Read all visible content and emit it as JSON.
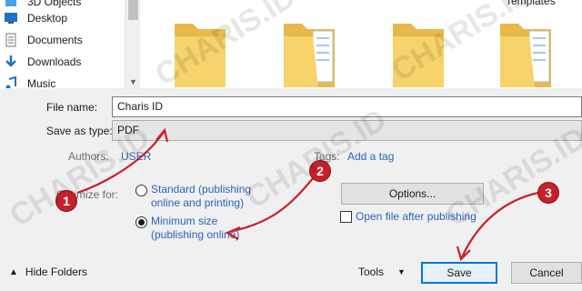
{
  "nav": {
    "items": [
      {
        "label": "3D Objects",
        "icon": "3d-objects-icon"
      },
      {
        "label": "Desktop",
        "icon": "desktop-icon"
      },
      {
        "label": "Documents",
        "icon": "documents-icon"
      },
      {
        "label": "Downloads",
        "icon": "downloads-icon"
      },
      {
        "label": "Music",
        "icon": "music-icon"
      }
    ]
  },
  "folders": {
    "last_label": "Templates"
  },
  "form": {
    "filename_label": "File name:",
    "filename_value": "Charis ID",
    "savetype_label": "Save as type:",
    "savetype_value": "PDF",
    "authors_label": "Authors:",
    "authors_value": "USER",
    "tags_label": "Tags:",
    "tags_value": "Add a tag",
    "optimize_label": "Optimize for:",
    "opt_standard": "Standard (publishing online and printing)",
    "opt_minimum": "Minimum size (publishing online)",
    "options_button": "Options...",
    "open_after_label": "Open file after publishing"
  },
  "footer": {
    "hide_folders": "Hide Folders",
    "tools": "Tools",
    "save": "Save",
    "cancel": "Cancel"
  },
  "annotations": {
    "badge1": "1",
    "badge2": "2",
    "badge3": "3",
    "watermark": "CHARIS.ID"
  },
  "colors": {
    "link": "#2b63b8",
    "badge": "#c8202a",
    "primary_border": "#0078d7"
  }
}
